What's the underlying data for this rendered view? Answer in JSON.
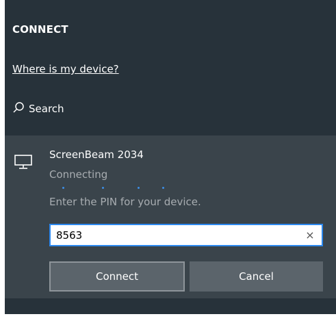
{
  "panel": {
    "title": "CONNECT",
    "help_link": "Where is my device?",
    "search_label": "Search",
    "search_icon": "search-icon"
  },
  "device": {
    "icon": "monitor-icon",
    "name": "ScreenBeam 2034",
    "status": "Connecting",
    "pin_prompt": "Enter the PIN for your device.",
    "pin_value": "8563",
    "clear_symbol": "×",
    "connect_label": "Connect",
    "cancel_label": "Cancel"
  },
  "colors": {
    "panel_bg": "#27323a",
    "card_bg": "#3a444b",
    "accent": "#2d89ef",
    "progress_dots": "#3d8ee6"
  }
}
